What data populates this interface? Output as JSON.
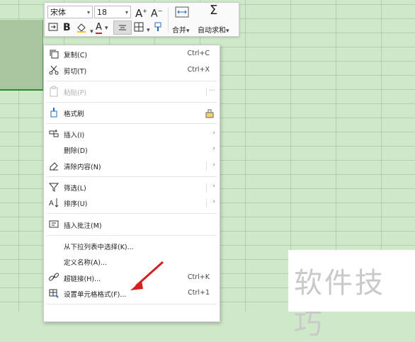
{
  "toolbar": {
    "font_name": "宋体",
    "font_size": "18",
    "grow_font_glyph": "A",
    "shrink_font_glyph": "A",
    "bold_glyph": "B",
    "font_color_glyph": "A",
    "merge_label": "合并",
    "autosum_label": "自动求和",
    "autosum_glyph": "Σ"
  },
  "menu": {
    "items": [
      {
        "label": "复制(C)",
        "shortcut": "Ctrl+C",
        "icon": "copy-icon"
      },
      {
        "label": "剪切(T)",
        "shortcut": "Ctrl+X",
        "icon": "scissors-icon"
      },
      {
        "label": "粘贴(P)",
        "shortcut": "···",
        "icon": "paste-icon",
        "disabled": true
      },
      {
        "label": "格式刷",
        "shortcut": "",
        "icon": "format-brush-icon"
      },
      {
        "label": "插入(I)",
        "icon": "insert-icon",
        "submenu": true
      },
      {
        "label": "删除(D)",
        "submenu": true
      },
      {
        "label": "清除内容(N)",
        "icon": "eraser-icon",
        "submenu": true
      },
      {
        "label": "筛选(L)",
        "icon": "filter-icon",
        "submenu": true
      },
      {
        "label": "排序(U)",
        "icon": "sort-icon",
        "submenu": true
      },
      {
        "label": "插入批注(M)",
        "icon": "comment-icon"
      },
      {
        "label": "从下拉列表中选择(K)..."
      },
      {
        "label": "定义名称(A)..."
      },
      {
        "label": "超链接(H)...",
        "shortcut": "Ctrl+K",
        "icon": "link-icon"
      },
      {
        "label": "设置单元格格式(F)...",
        "shortcut": "Ctrl+1",
        "icon": "format-cells-icon"
      }
    ],
    "submenu_arrow": "›"
  },
  "watermark": "软件技巧"
}
